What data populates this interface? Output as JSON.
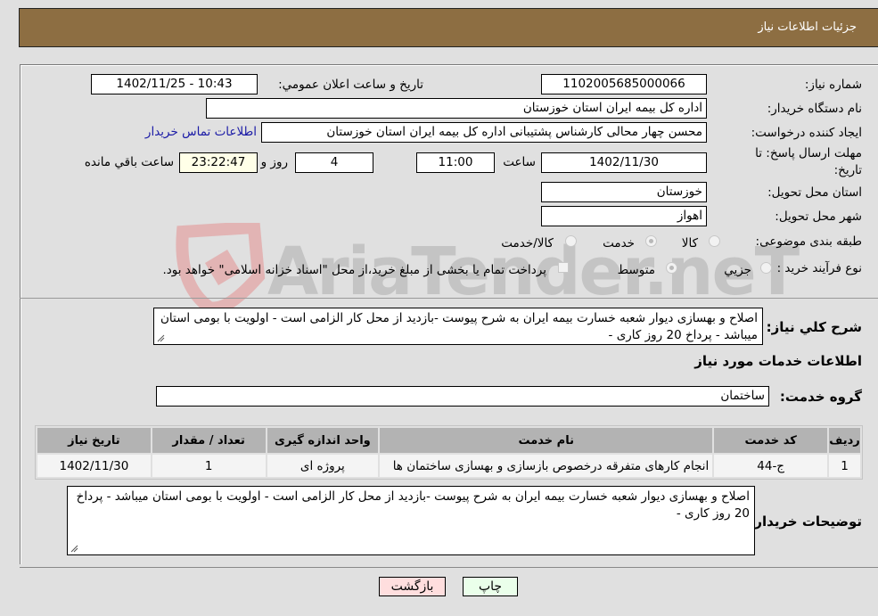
{
  "header": {
    "title": "جزئیات اطلاعات نیاز"
  },
  "form": {
    "need_number_label": "شماره نیاز:",
    "need_number": "1102005685000066",
    "announce_label": "تاريخ و ساعت اعلان عمومي:",
    "announce_value": "1402/11/25 - 10:43",
    "buyer_org_label": "نام دستگاه خريدار:",
    "buyer_org": "اداره کل بیمه ایران استان خوزستان",
    "creator_label": "ايجاد كننده درخواست:",
    "creator": "محسن چهار محالی کارشناس پشتیبانی اداره کل بیمه ایران استان خوزستان",
    "contact_link": "اطلاعات تماس خريدار",
    "deadline_label_line1": "مهلت ارسال پاسخ: تا",
    "deadline_label_line2": "تاريخ:",
    "deadline_date": "1402/11/30",
    "time_label": "ساعت",
    "deadline_time": "11:00",
    "days_value": "4",
    "days_label": "روز و",
    "remaining_time": "23:22:47",
    "remaining_label": "ساعت باقي مانده",
    "province_label": "استان محل تحويل:",
    "province": "خوزستان",
    "city_label": "شهر محل تحويل:",
    "city": "اهواز",
    "category_label": "طبقه بندی موضوعی:",
    "category_options": [
      {
        "label": "کالا",
        "checked": false
      },
      {
        "label": "خدمت",
        "checked": true
      },
      {
        "label": "کالا/خدمت",
        "checked": false
      }
    ],
    "process_label": "نوع فرآيند خريد :",
    "process_options": [
      {
        "label": "جزيي",
        "checked": false
      },
      {
        "label": "متوسط",
        "checked": true
      }
    ],
    "treasury_checkbox_label": "پرداخت تمام يا بخشی از مبلغ خريد،از محل \"اسناد خزانه اسلامی\" خواهد بود.",
    "treasury_checked": false
  },
  "description": {
    "label": "شرح كلي نياز:",
    "text": "اصلاح  و بهسازی دیوار شعبه خسارت بیمه ایران  به شرح پیوست -بازدید از محل کار الزامی است - اولویت با بومی استان میباشد - پرداخ 20 روز کاری -"
  },
  "services": {
    "section_title": "اطلاعات خدمات مورد نياز",
    "group_label": "گروه خدمت:",
    "group_value": "ساختمان",
    "columns": [
      "رديف",
      "كد خدمت",
      "نام خدمت",
      "واحد اندازه گيری",
      "تعداد / مقدار",
      "تاريخ نياز"
    ],
    "rows": [
      [
        "1",
        "ج-44",
        "انجام کارهای متفرقه درخصوص بازسازی و بهسازی ساختمان ها",
        "پروژه ای",
        "1",
        "1402/11/30"
      ]
    ]
  },
  "buyer_notes": {
    "label": "توضيحات خريدار:",
    "text": "اصلاح  و بهسازی دیوار شعبه خسارت بیمه ایران  به شرح پیوست -بازدید از محل کار الزامی است - اولویت با بومی استان میباشد - پرداخ 20 روز کاری -"
  },
  "buttons": {
    "print": "چاپ",
    "back": "بازگشت"
  },
  "watermark": {
    "text": "AriaTender.neT"
  },
  "colors": {
    "header_bg": "#8d6e42",
    "print_bg": "#eaffea",
    "back_bg": "#ffdede",
    "link": "#1a1aa6"
  }
}
